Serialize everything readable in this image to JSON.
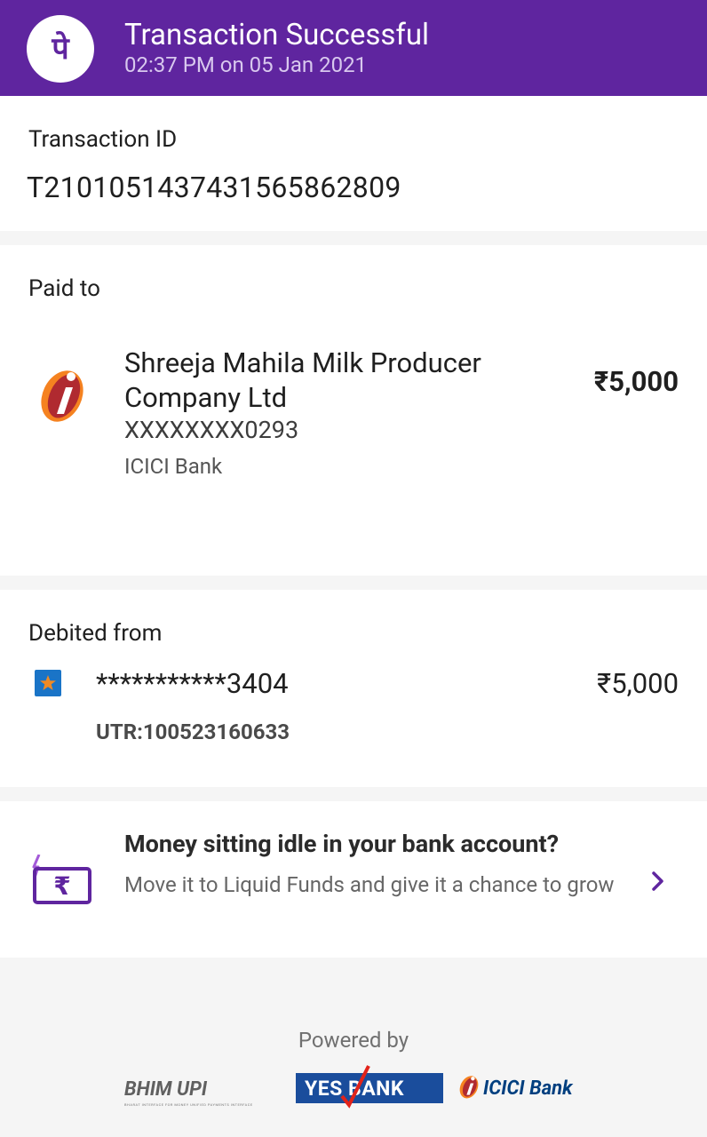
{
  "header": {
    "title": "Transaction Successful",
    "subtitle": "02:37 PM on 05 Jan 2021",
    "bg_color": "#5f259f",
    "logo_icon": "phonepe-logo"
  },
  "transaction": {
    "label": "Transaction ID",
    "id": "T2101051437431565862809"
  },
  "paid_to": {
    "label": "Paid to",
    "name": "Shreeja Mahila Milk Producer Company Ltd",
    "account": "XXXXXXXX0293",
    "bank": "ICICI Bank",
    "amount": "₹5,000",
    "icon": "icici-logo"
  },
  "debited_from": {
    "label": "Debited from",
    "account": "***********3404",
    "amount": "₹5,000",
    "utr": "UTR:100523160633",
    "icon": "bank-of-india-icon"
  },
  "promo": {
    "title": "Money sitting idle in your bank account?",
    "text": "Move it to Liquid Funds and give it a chance to grow",
    "icon": "rupee-card-icon",
    "accent": "#5f259f"
  },
  "footer": {
    "powered_by": "Powered by",
    "partners": {
      "bhim_upi": "BHIM UPI",
      "bhim_tag": "BHARAT INTERFACE FOR MONEY   UNIFIED PAYMENTS INTERFACE",
      "yes_bank": "YES BANK",
      "icici": "ICICI Bank"
    }
  }
}
